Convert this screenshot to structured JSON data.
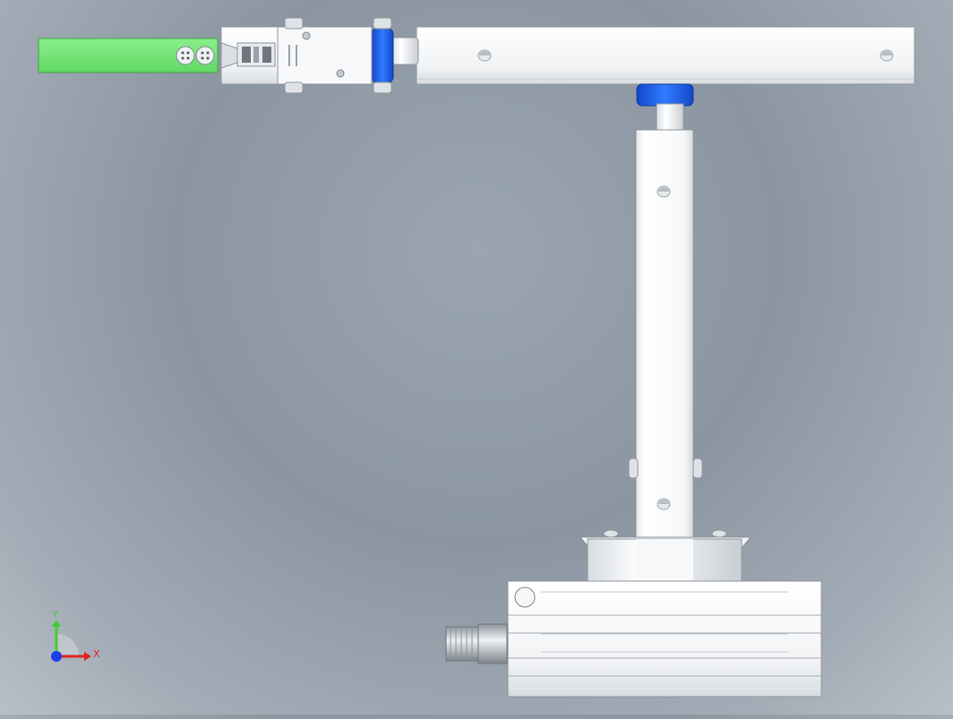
{
  "viewport": {
    "background": "#939ea9"
  },
  "triad": {
    "x_label": "X",
    "y_label": "Y",
    "x_color": "#e0241f",
    "y_color": "#3bd12f",
    "z_color": "#1f3fe6"
  },
  "model": {
    "body_color": "#f2f4f6",
    "accent_color": "#1f6cf2",
    "gripper_color": "#7bea7b"
  }
}
